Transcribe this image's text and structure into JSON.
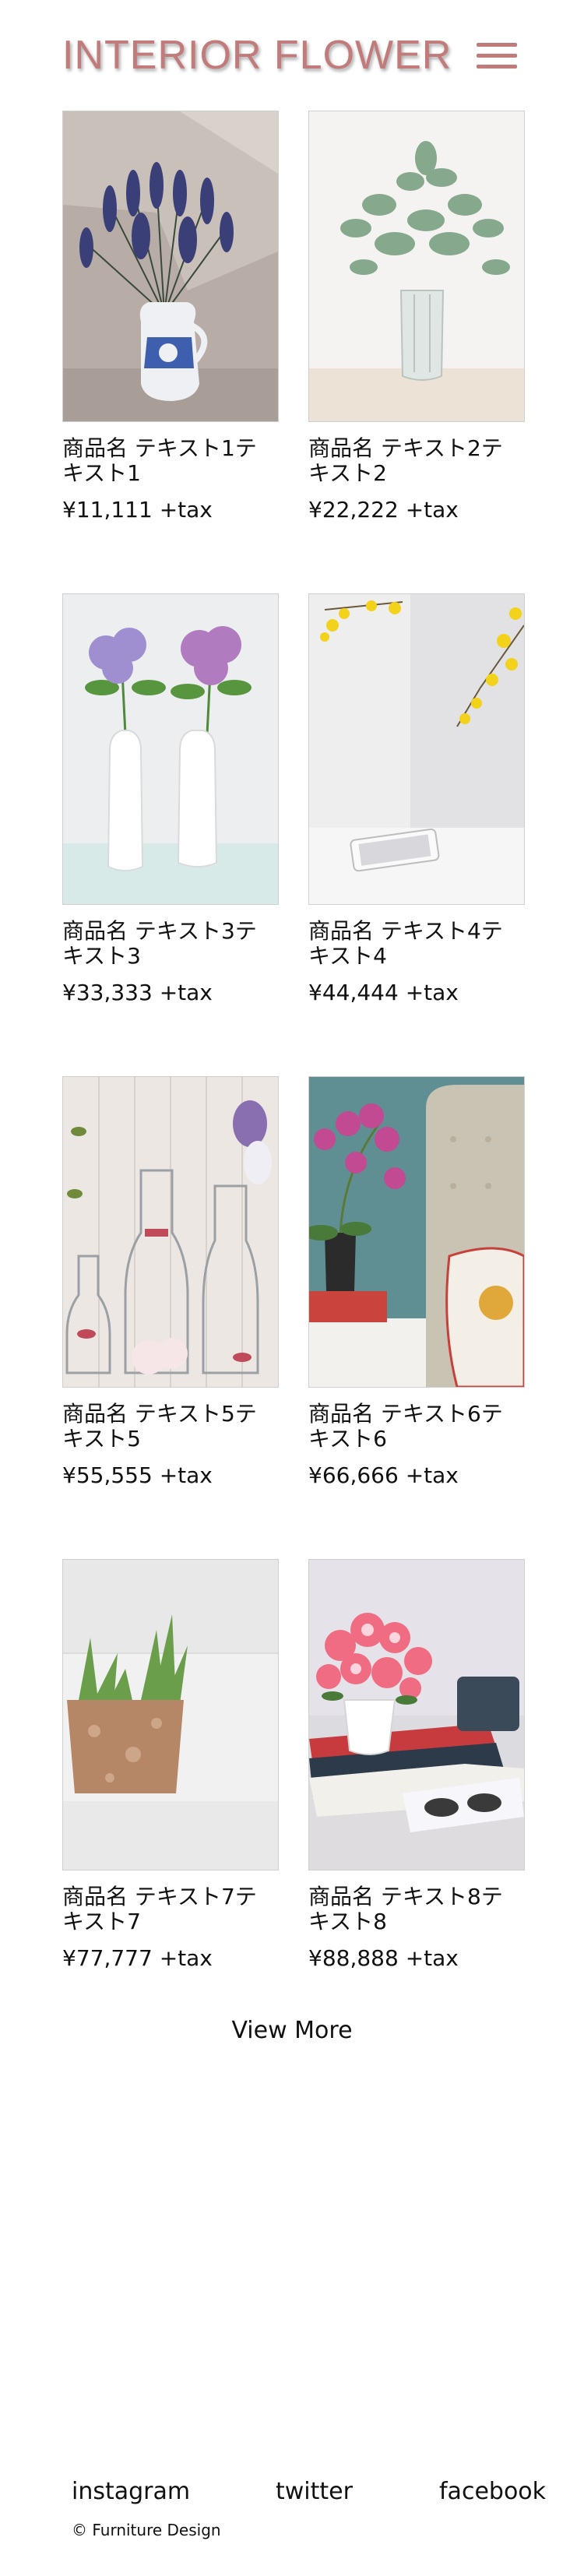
{
  "header": {
    "logo": "INTERIOR FLOWER",
    "menu_icon": "hamburger-menu-icon",
    "brand_color": "#c17b7b"
  },
  "products": [
    {
      "name": "商品名 テキスト1テキスト1",
      "price": "¥11,111 +tax",
      "image": "lavender-in-blue-pitcher"
    },
    {
      "name": "商品名 テキスト2テキスト2",
      "price": "¥22,222 +tax",
      "image": "eucalyptus-in-glass-vase"
    },
    {
      "name": "商品名 テキスト3テキスト3",
      "price": "¥33,333 +tax",
      "image": "hydrangeas-in-white-bottles"
    },
    {
      "name": "商品名 テキスト4テキスト4",
      "price": "¥44,444 +tax",
      "image": "yellow-forsythia-and-phone"
    },
    {
      "name": "商品名 テキスト5テキスト5",
      "price": "¥55,555 +tax",
      "image": "glass-bottles-with-flowers"
    },
    {
      "name": "商品名 テキスト6テキスト6",
      "price": "¥66,666 +tax",
      "image": "pink-orchid-by-chair"
    },
    {
      "name": "商品名 テキスト7テキスト7",
      "price": "¥77,777 +tax",
      "image": "succulents-in-clay-pot"
    },
    {
      "name": "商品名 テキスト8テキスト8",
      "price": "¥88,888 +tax",
      "image": "pink-flowers-on-books"
    }
  ],
  "view_more": "View More",
  "footer": {
    "links": [
      "instagram",
      "twitter",
      "facebook"
    ],
    "copyright": "© Furniture Design"
  }
}
